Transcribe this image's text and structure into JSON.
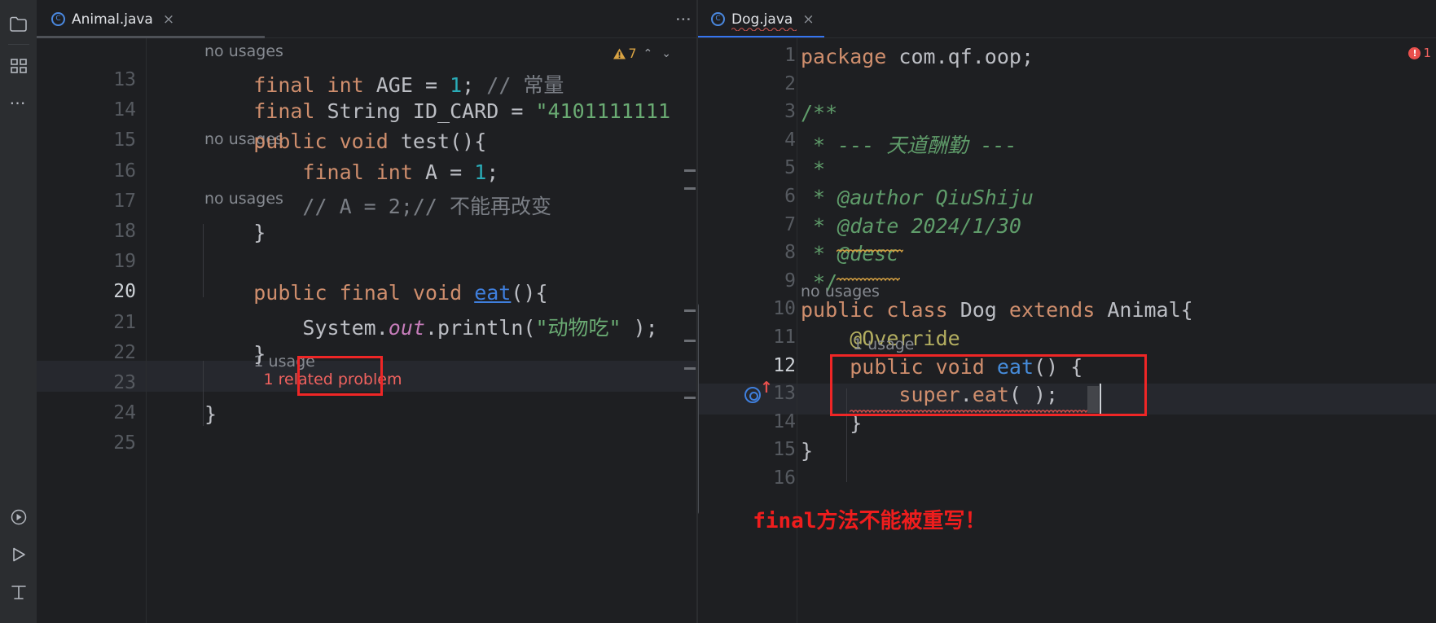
{
  "app": {
    "theme_bg": "#1e1f22",
    "accent": "#3574f0",
    "error_color": "#e8504d",
    "annotation_color": "#ef1d1d"
  },
  "rail": {
    "items": [
      {
        "name": "project-folder-icon",
        "label": ""
      },
      {
        "name": "structure-icon",
        "label": ""
      },
      {
        "name": "more-tool-windows-icon",
        "label": "…"
      },
      {
        "name": "run-icon",
        "label": ""
      },
      {
        "name": "run-play-icon",
        "label": ""
      },
      {
        "name": "terminal-icon",
        "label": ""
      }
    ]
  },
  "left_editor": {
    "tab": {
      "filename": "Animal.java",
      "close": "×",
      "icon": "java-class-icon",
      "active": false
    },
    "kebab": "⋮",
    "inspections": {
      "warning_count": "7",
      "warning_glyph": "!",
      "up": "⌃",
      "down": "⌄"
    },
    "current_line": "20",
    "line_numbers": [
      "13",
      "14",
      "15",
      "16",
      "17",
      "18",
      "19",
      "20",
      "21",
      "22",
      "23",
      "24",
      "25"
    ],
    "hints": [
      {
        "text": "no usages",
        "problem": ""
      },
      {
        "text": "no usages",
        "problem": ""
      },
      {
        "text": "no usages",
        "problem": ""
      },
      {
        "text": "1 usage  ",
        "problem": "1 related problem"
      }
    ],
    "lines": [
      {
        "num": "13",
        "segments": [
          {
            "t": "    ",
            "c": "punc"
          },
          {
            "t": "final",
            "c": "kw"
          },
          {
            "t": " ",
            "c": "punc"
          },
          {
            "t": "int",
            "c": "kw"
          },
          {
            "t": " AGE ",
            "c": "var"
          },
          {
            "t": "=",
            "c": "punc"
          },
          {
            "t": " ",
            "c": "punc"
          },
          {
            "t": "1",
            "c": "num"
          },
          {
            "t": "; ",
            "c": "punc"
          },
          {
            "t": "// 常量",
            "c": "cmt"
          }
        ]
      },
      {
        "num": "14",
        "segments": [
          {
            "t": "    ",
            "c": "punc"
          },
          {
            "t": "final",
            "c": "kw"
          },
          {
            "t": " ",
            "c": "punc"
          },
          {
            "t": "String",
            "c": "ty"
          },
          {
            "t": " ID_CARD ",
            "c": "var"
          },
          {
            "t": "=",
            "c": "punc"
          },
          {
            "t": " ",
            "c": "punc"
          },
          {
            "t": "\"4101111111",
            "c": "str"
          }
        ]
      },
      {
        "num": "15",
        "segments": [
          {
            "t": "    ",
            "c": "punc"
          },
          {
            "t": "public",
            "c": "kw"
          },
          {
            "t": " ",
            "c": "punc"
          },
          {
            "t": "void",
            "c": "kw"
          },
          {
            "t": " ",
            "c": "punc"
          },
          {
            "t": "test",
            "c": "fn"
          },
          {
            "t": "(){",
            "c": "punc"
          }
        ]
      },
      {
        "num": "16",
        "segments": [
          {
            "t": "        ",
            "c": "punc"
          },
          {
            "t": "final",
            "c": "kw"
          },
          {
            "t": " ",
            "c": "punc"
          },
          {
            "t": "int",
            "c": "kw"
          },
          {
            "t": " A ",
            "c": "var"
          },
          {
            "t": "=",
            "c": "punc"
          },
          {
            "t": " ",
            "c": "punc"
          },
          {
            "t": "1",
            "c": "num"
          },
          {
            "t": ";",
            "c": "punc"
          }
        ]
      },
      {
        "num": "17",
        "segments": [
          {
            "t": "        ",
            "c": "punc"
          },
          {
            "t": "// A = 2;// 不能再改变",
            "c": "cmt"
          }
        ]
      },
      {
        "num": "18",
        "segments": [
          {
            "t": "    }",
            "c": "punc"
          }
        ]
      },
      {
        "num": "19",
        "segments": [
          {
            "t": "",
            "c": "punc"
          }
        ]
      },
      {
        "num": "20",
        "segments": [
          {
            "t": "    ",
            "c": "punc"
          },
          {
            "t": "public",
            "c": "kw"
          },
          {
            "t": " ",
            "c": "punc"
          },
          {
            "t": "final",
            "c": "kw"
          },
          {
            "t": " ",
            "c": "punc"
          },
          {
            "t": "void",
            "c": "kw"
          },
          {
            "t": " ",
            "c": "punc"
          },
          {
            "t": "eat",
            "c": "link"
          },
          {
            "t": "(){",
            "c": "punc"
          }
        ]
      },
      {
        "num": "21",
        "segments": [
          {
            "t": "        ",
            "c": "punc"
          },
          {
            "t": "System",
            "c": "ty"
          },
          {
            "t": ".",
            "c": "punc"
          },
          {
            "t": "out",
            "c": "field-it"
          },
          {
            "t": ".",
            "c": "punc"
          },
          {
            "t": "println",
            "c": "fn"
          },
          {
            "t": "(",
            "c": "punc"
          },
          {
            "t": "\"动物吃\"",
            "c": "str"
          },
          {
            "t": " );",
            "c": "punc"
          }
        ]
      },
      {
        "num": "22",
        "segments": [
          {
            "t": "    }",
            "c": "punc"
          }
        ]
      },
      {
        "num": "23",
        "segments": [
          {
            "t": "",
            "c": "punc"
          }
        ]
      },
      {
        "num": "24",
        "segments": [
          {
            "t": "}",
            "c": "punc"
          }
        ]
      },
      {
        "num": "25",
        "segments": [
          {
            "t": "",
            "c": "punc"
          }
        ]
      }
    ]
  },
  "right_editor": {
    "tab": {
      "filename": "Dog.java",
      "close": "×",
      "icon": "java-class-icon",
      "active": true
    },
    "errors": {
      "count": "1",
      "glyph": "!"
    },
    "current_line": "12",
    "line_numbers": [
      "1",
      "2",
      "3",
      "4",
      "5",
      "6",
      "7",
      "8",
      "9",
      "10",
      "11",
      "12",
      "13",
      "14",
      "15",
      "16"
    ],
    "hints": [
      {
        "text": "no usages"
      },
      {
        "text": "1 usage"
      }
    ],
    "lines": [
      {
        "num": "1",
        "segments": [
          {
            "t": "package",
            "c": "kw"
          },
          {
            "t": " ",
            "c": "punc"
          },
          {
            "t": "com.qf.oop",
            "c": "ty"
          },
          {
            "t": ";",
            "c": "punc"
          }
        ]
      },
      {
        "num": "2",
        "segments": [
          {
            "t": "",
            "c": "punc"
          }
        ]
      },
      {
        "num": "3",
        "segments": [
          {
            "t": "/**",
            "c": "doc-plain"
          }
        ]
      },
      {
        "num": "4",
        "segments": [
          {
            "t": " * ",
            "c": "doc-plain"
          },
          {
            "t": "--- ",
            "c": "doc"
          },
          {
            "t": "天道酬勤",
            "c": "doc"
          },
          {
            "t": " ---",
            "c": "doc"
          }
        ]
      },
      {
        "num": "5",
        "segments": [
          {
            "t": " *",
            "c": "doc-plain"
          }
        ]
      },
      {
        "num": "6",
        "segments": [
          {
            "t": " * ",
            "c": "doc-plain"
          },
          {
            "t": "@author",
            "c": "doc"
          },
          {
            "t": " QiuShiju",
            "c": "doc"
          }
        ]
      },
      {
        "num": "7",
        "segments": [
          {
            "t": " * ",
            "c": "doc-plain"
          },
          {
            "t": "@date",
            "c": "doc"
          },
          {
            "t": " 2024/1/30",
            "c": "doc"
          }
        ]
      },
      {
        "num": "8",
        "segments": [
          {
            "t": " * ",
            "c": "doc-plain"
          },
          {
            "t": "@desc",
            "c": "doc"
          }
        ]
      },
      {
        "num": "9",
        "segments": [
          {
            "t": " */",
            "c": "doc-plain"
          }
        ]
      },
      {
        "num": "10",
        "segments": [
          {
            "t": "public",
            "c": "kw"
          },
          {
            "t": " ",
            "c": "punc"
          },
          {
            "t": "class",
            "c": "kw"
          },
          {
            "t": " ",
            "c": "punc"
          },
          {
            "t": "Dog",
            "c": "ty"
          },
          {
            "t": " ",
            "c": "punc"
          },
          {
            "t": "extends",
            "c": "kw"
          },
          {
            "t": " ",
            "c": "punc"
          },
          {
            "t": "Animal",
            "c": "ty"
          },
          {
            "t": "{",
            "c": "punc"
          }
        ]
      },
      {
        "num": "11",
        "segments": [
          {
            "t": "    ",
            "c": "punc"
          },
          {
            "t": "@Override",
            "c": "anno"
          }
        ]
      },
      {
        "num": "12",
        "segments": [
          {
            "t": "    ",
            "c": "punc"
          },
          {
            "t": "public",
            "c": "kw"
          },
          {
            "t": " ",
            "c": "punc"
          },
          {
            "t": "void",
            "c": "kw"
          },
          {
            "t": " ",
            "c": "punc"
          },
          {
            "t": "eat",
            "c": "fnblue"
          },
          {
            "t": "() ",
            "c": "punc"
          },
          {
            "t": "{",
            "c": "punc"
          }
        ]
      },
      {
        "num": "13",
        "segments": [
          {
            "t": "        ",
            "c": "punc"
          },
          {
            "t": "super",
            "c": "kw"
          },
          {
            "t": ".",
            "c": "punc"
          },
          {
            "t": "eat",
            "c": "kw"
          },
          {
            "t": "( );",
            "c": "punc"
          }
        ]
      },
      {
        "num": "14",
        "segments": [
          {
            "t": "    }",
            "c": "punc"
          }
        ]
      },
      {
        "num": "15",
        "segments": [
          {
            "t": "}",
            "c": "punc"
          }
        ]
      },
      {
        "num": "16",
        "segments": [
          {
            "t": "",
            "c": "punc"
          }
        ]
      }
    ],
    "gutter_marker": {
      "name": "overriding-method-marker",
      "arrow": "↑"
    }
  },
  "annotations": {
    "box_left_label": "final",
    "box_right_label": "public void eat() {",
    "caption_mono": "final",
    "caption_cjk": "方法不能被重写！"
  }
}
